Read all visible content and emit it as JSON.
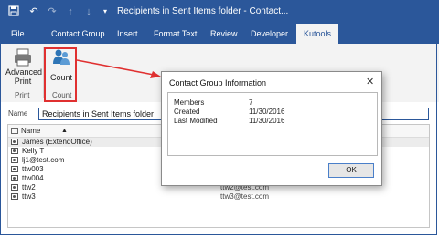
{
  "window": {
    "title": "Recipients in Sent Items folder  -  Contact..."
  },
  "quick_access": [
    {
      "icon": "save-icon"
    },
    {
      "icon": "undo-icon"
    },
    {
      "icon": "redo-icon"
    },
    {
      "icon": "up-icon"
    },
    {
      "icon": "down-icon"
    },
    {
      "icon": "customize-icon"
    }
  ],
  "tabs": [
    "File",
    "Contact Group",
    "Insert",
    "Format Text",
    "Review",
    "Developer",
    "Kutools"
  ],
  "active_tab": "Kutools",
  "ribbon": {
    "advanced_print": {
      "line1": "Advanced",
      "line2": "Print"
    },
    "count_label": "Count",
    "groups": [
      "Print",
      "Count"
    ]
  },
  "name_field": {
    "label": "Name",
    "value": "Recipients in Sent Items folder"
  },
  "list": {
    "header": "Name",
    "rows": [
      {
        "name": "James (ExtendOffice)",
        "email": ""
      },
      {
        "name": "Kelly T",
        "email": ""
      },
      {
        "name": "lj1@test.com",
        "email": ""
      },
      {
        "name": "ttw003",
        "email": ""
      },
      {
        "name": "ttw004",
        "email": ""
      },
      {
        "name": "ttw2",
        "email": "ttw2@test.com"
      },
      {
        "name": "ttw3",
        "email": "ttw3@test.com"
      }
    ]
  },
  "dialog": {
    "title": "Contact Group Information",
    "fields": [
      {
        "label": "Members",
        "value": "7"
      },
      {
        "label": "Created",
        "value": "11/30/2016"
      },
      {
        "label": "Last Modified",
        "value": "11/30/2016"
      }
    ],
    "ok_label": "OK"
  },
  "colors": {
    "accent": "#2b579a",
    "highlight": "#e03030"
  }
}
